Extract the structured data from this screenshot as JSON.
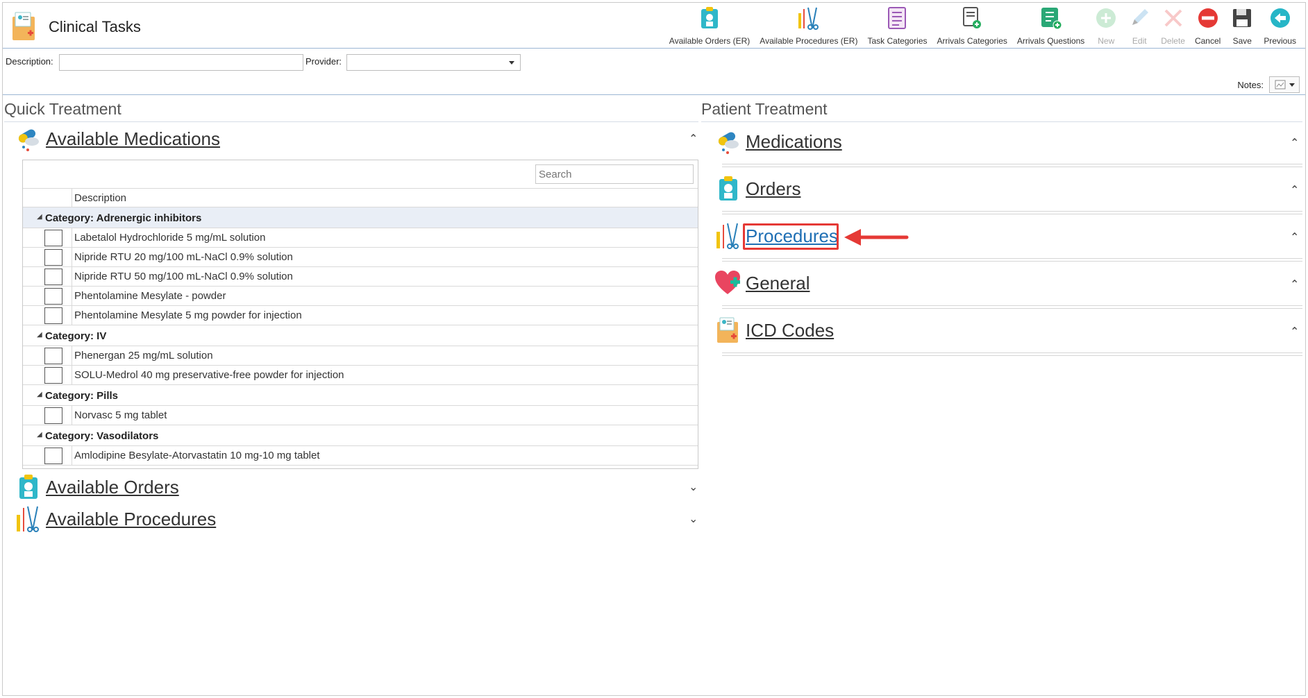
{
  "header": {
    "title": "Clinical Tasks",
    "app_icon": "medical-folder-icon"
  },
  "toolbar": [
    {
      "label": "Available Orders (ER)",
      "icon": "clipboard-doctor-icon",
      "enabled": true
    },
    {
      "label": "Available Procedures (ER)",
      "icon": "surgical-tools-icon",
      "enabled": true
    },
    {
      "label": "Task Categories",
      "icon": "task-list-icon",
      "enabled": true
    },
    {
      "label": "Arrivals Categories",
      "icon": "document-add-icon",
      "enabled": true
    },
    {
      "label": "Arrivals Questions",
      "icon": "checklist-add-icon",
      "enabled": true
    },
    {
      "label": "New",
      "icon": "plus-circle-icon",
      "enabled": false
    },
    {
      "label": "Edit",
      "icon": "pencil-icon",
      "enabled": false
    },
    {
      "label": "Delete",
      "icon": "x-icon",
      "enabled": false
    },
    {
      "label": "Cancel",
      "icon": "no-entry-icon",
      "enabled": true
    },
    {
      "label": "Save",
      "icon": "floppy-disk-icon",
      "enabled": true
    },
    {
      "label": "Previous",
      "icon": "arrow-left-circle-icon",
      "enabled": true
    }
  ],
  "filters": {
    "description_label": "Description:",
    "description_value": "",
    "provider_label": "Provider:",
    "provider_value": "",
    "notes_label": "Notes:"
  },
  "quick_treatment": {
    "title": "Quick Treatment",
    "sections": [
      {
        "title": "Available Medications",
        "icon": "pills-icon",
        "expanded": true
      },
      {
        "title": "Available Orders",
        "icon": "clipboard-doctor-icon",
        "expanded": false
      },
      {
        "title": "Available Procedures",
        "icon": "surgical-tools-icon",
        "expanded": false
      }
    ],
    "grid": {
      "search_placeholder": "Search",
      "column_description": "Description",
      "categories": [
        {
          "label": "Category: Adrenergic inhibitors",
          "items": [
            "Labetalol Hydrochloride 5 mg/mL solution",
            "Nipride RTU 20 mg/100 mL-NaCl 0.9% solution",
            "Nipride RTU 50 mg/100 mL-NaCl 0.9% solution",
            "Phentolamine Mesylate - powder",
            "Phentolamine Mesylate 5 mg powder for injection"
          ]
        },
        {
          "label": "Category: IV",
          "items": [
            "Phenergan 25 mg/mL solution",
            "SOLU-Medrol 40 mg preservative-free powder for injection"
          ]
        },
        {
          "label": "Category: Pills",
          "items": [
            "Norvasc 5 mg tablet"
          ]
        },
        {
          "label": "Category: Vasodilators",
          "items": [
            "Amlodipine Besylate-Atorvastatin 10 mg-10 mg tablet"
          ]
        }
      ]
    }
  },
  "patient_treatment": {
    "title": "Patient Treatment",
    "sections": [
      {
        "title": "Medications",
        "icon": "pills-icon"
      },
      {
        "title": "Orders",
        "icon": "clipboard-doctor-icon"
      },
      {
        "title": "Procedures",
        "icon": "surgical-tools-icon",
        "highlighted": true
      },
      {
        "title": "General",
        "icon": "heart-plus-icon"
      },
      {
        "title": "ICD Codes",
        "icon": "medical-folder-icon"
      }
    ]
  },
  "colors": {
    "accent_link": "#1f6fb4",
    "highlight": "#e53935",
    "header_rule": "#9bb6d3"
  }
}
